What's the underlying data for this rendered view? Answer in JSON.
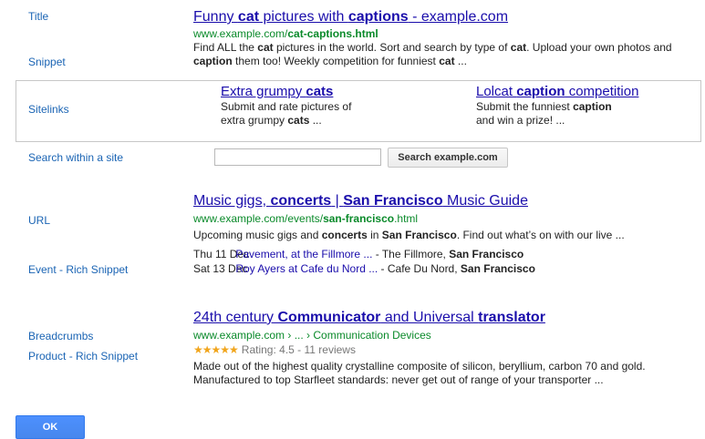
{
  "labels": {
    "title": "Title",
    "snippet": "Snippet",
    "sitelinks": "Sitelinks",
    "search_within": "Search within a site",
    "url": "URL",
    "event": "Event - Rich Snippet",
    "breadcrumbs": "Breadcrumbs",
    "product": "Product - Rich Snippet"
  },
  "result1": {
    "title": [
      {
        "text": "Funny ",
        "bold": false
      },
      {
        "text": "cat",
        "bold": true
      },
      {
        "text": " pictures with ",
        "bold": false
      },
      {
        "text": "captions",
        "bold": true
      },
      {
        "text": " - example.com",
        "bold": false
      }
    ],
    "url": [
      {
        "text": "www.example.com/",
        "bold": false
      },
      {
        "text": "cat-captions",
        "bold": true
      },
      {
        "text": ".html",
        "bold": true
      }
    ],
    "snippet": [
      {
        "text": "Find ALL the ",
        "bold": false
      },
      {
        "text": "cat",
        "bold": true
      },
      {
        "text": " pictures in the world. Sort and search by type of ",
        "bold": false
      },
      {
        "text": "cat",
        "bold": true
      },
      {
        "text": ". Upload your own photos and ",
        "bold": false
      },
      {
        "text": "caption",
        "bold": true
      },
      {
        "text": " them too! Weekly competition for funniest ",
        "bold": false
      },
      {
        "text": "cat",
        "bold": true
      },
      {
        "text": " ...",
        "bold": false
      }
    ]
  },
  "sitelinks": [
    {
      "title": [
        {
          "text": "Extra grumpy ",
          "bold": false
        },
        {
          "text": "cats",
          "bold": true
        }
      ],
      "desc": [
        {
          "text": "Submit and rate pictures of",
          "bold": false
        },
        {
          "text": "\nextra grumpy ",
          "bold": false
        },
        {
          "text": "cats",
          "bold": true
        },
        {
          "text": " ...",
          "bold": false
        }
      ]
    },
    {
      "title": [
        {
          "text": "Lolcat ",
          "bold": false
        },
        {
          "text": "caption",
          "bold": true
        },
        {
          "text": " competition",
          "bold": false
        }
      ],
      "desc": [
        {
          "text": "Submit the funniest ",
          "bold": false
        },
        {
          "text": "caption",
          "bold": true
        },
        {
          "text": "\nand win a prize! ...",
          "bold": false
        }
      ]
    }
  ],
  "search": {
    "value": "",
    "button_label": "Search example.com"
  },
  "result2": {
    "title": [
      {
        "text": "Music gigs, ",
        "bold": false
      },
      {
        "text": "concerts",
        "bold": true
      },
      {
        "text": " | ",
        "bold": false
      },
      {
        "text": "San Francisco",
        "bold": true
      },
      {
        "text": " Music Guide",
        "bold": false
      }
    ],
    "url": [
      {
        "text": "www.example.com/events/",
        "bold": false
      },
      {
        "text": "san-francisco",
        "bold": true
      },
      {
        "text": ".html",
        "bold": false
      }
    ],
    "snippet": [
      {
        "text": "Upcoming music gigs and ",
        "bold": false
      },
      {
        "text": "concerts",
        "bold": true
      },
      {
        "text": " in ",
        "bold": false
      },
      {
        "text": "San Francisco",
        "bold": true
      },
      {
        "text": ". Find out what’s on with our live ...",
        "bold": false
      }
    ],
    "events": [
      {
        "date": "Thu 11 Dec",
        "link": "Pavement, at the Fillmore ...",
        "venue": " - The Fillmore, ",
        "city": "San Francisco"
      },
      {
        "date": "Sat 13 Dec",
        "link": "Roy Ayers at Cafe du Nord ...",
        "venue": " - Cafe Du Nord, ",
        "city": "San Francisco"
      }
    ]
  },
  "result3": {
    "title": [
      {
        "text": "24th century ",
        "bold": false
      },
      {
        "text": "Communicator",
        "bold": true
      },
      {
        "text": " and Universal ",
        "bold": false
      },
      {
        "text": "translator",
        "bold": true
      }
    ],
    "breadcrumb": [
      {
        "text": "www.example.com"
      },
      {
        "text": "..."
      },
      {
        "text": "Communication Devices"
      }
    ],
    "breadcrumb_sep": " › ",
    "rating_stars": 4.5,
    "rating_text": "Rating: 4.5 - 11 reviews",
    "snippet": [
      {
        "text": "Made out of the highest quality crystalline composite of silicon, beryllium, carbon 70 and gold. Manufactured to top Starfleet standards: never get out of range of your transporter ...",
        "bold": false
      }
    ]
  },
  "ok_label": "OK",
  "colors": {
    "label": "#1a64b4",
    "link": "#1a0dab",
    "url": "#0a8a2a",
    "star": "#f1a51c",
    "ok_button": "#4d90fe"
  }
}
